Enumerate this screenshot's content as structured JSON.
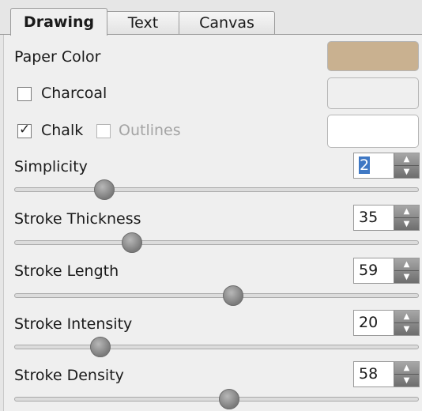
{
  "tabs": [
    {
      "label": "Drawing",
      "active": true
    },
    {
      "label": "Text",
      "active": false
    },
    {
      "label": "Canvas",
      "active": false
    }
  ],
  "paper_color": {
    "label": "Paper Color",
    "color": "#c9b190"
  },
  "charcoal": {
    "label": "Charcoal",
    "checked": false
  },
  "chalk": {
    "label": "Chalk",
    "checked": true
  },
  "outlines": {
    "label": "Outlines",
    "checked": false,
    "enabled": false
  },
  "swatches": {
    "charcoal_color": "#efefef",
    "chalk_color": "#ffffff"
  },
  "settings": [
    {
      "label": "Simplicity",
      "value": "2",
      "selected": true,
      "fraction": 0.22
    },
    {
      "label": "Stroke Thickness",
      "value": "35",
      "selected": false,
      "fraction": 0.29
    },
    {
      "label": "Stroke Length",
      "value": "59",
      "selected": false,
      "fraction": 0.54
    },
    {
      "label": "Stroke Intensity",
      "value": "20",
      "selected": false,
      "fraction": 0.21
    },
    {
      "label": "Stroke Density",
      "value": "58",
      "selected": false,
      "fraction": 0.53
    }
  ],
  "icons": {
    "spin_up": "triangle-up-icon",
    "spin_down": "triangle-down-icon",
    "check": "checkmark-icon"
  }
}
